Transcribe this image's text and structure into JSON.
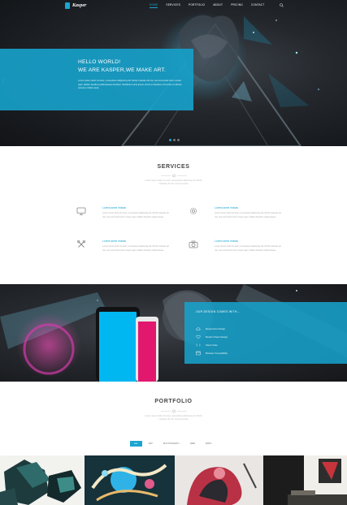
{
  "nav": {
    "logo": "Kasper",
    "items": [
      {
        "label": "HOME",
        "active": true
      },
      {
        "label": "SERVICES",
        "active": false
      },
      {
        "label": "PORTFOLIO",
        "active": false
      },
      {
        "label": "ABOUT",
        "active": false
      },
      {
        "label": "PRICING",
        "active": false
      },
      {
        "label": "CONTACT",
        "active": false
      }
    ],
    "search_icon": "search-icon"
  },
  "hero": {
    "title_line1": "HELLO WORLD!",
    "title_line2": "WE ARE KASPER,WE MAKE ART.",
    "text": "Lorem ipsum dolor sit amet, consectetur adipiscing elit. Morbi molestie elit nisi, sed commodo lorem ornare eget. Nullam faucibus pellentesque tincidunt. Vestibulum ante ipsum primis in faucibus orci luctus et ultrices posuere cubilia curae.",
    "accent": "#1ba5d1",
    "slides": 3,
    "active_slide": 1
  },
  "services": {
    "title": "SERVICES",
    "subtitle_line1": "Lorem ipsum dolor sit amet, consectetur adipiscing elit. Morbi",
    "subtitle_line2": "molestie elit nisi, sed commodo",
    "items": [
      {
        "icon": "monitor-icon",
        "title": "Lorem amet irnidas",
        "text": "Lorem ipsum dolor sit amet, consectetur adipiscing elit. Morbi molestie elit nisi, sed commodo lorem ornare eget. Nullam faucibus pellentesque."
      },
      {
        "icon": "gear-icon",
        "title": "Lorem amet irnidas",
        "text": "Lorem ipsum dolor sit amet, consectetur adipiscing elit. Morbi molestie elit nisi, sed commodo lorem ornare eget. Nullam faucibus pellentesque."
      },
      {
        "icon": "tools-icon",
        "title": "Lorem amet irnidas",
        "text": "Lorem ipsum dolor sit amet, consectetur adipiscing elit. Morbi molestie elit nisi, sed commodo lorem ornare eget. Nullam faucibus pellentesque."
      },
      {
        "icon": "camera-icon",
        "title": "Lorem amet irnidas",
        "text": "Lorem ipsum dolor sit amet, consectetur adipiscing elit. Morbi molestie elit nisi, sed commodo lorem ornare eget. Nullam faucibus pellentesque."
      }
    ]
  },
  "features": {
    "title": "OUR DESIGN COMES WITH...",
    "items": [
      {
        "icon": "cloud-icon",
        "label": "Responsive Design"
      },
      {
        "icon": "heart-icon",
        "label": "Modern Clean Design"
      },
      {
        "icon": "code-icon",
        "label": "Clean Code"
      },
      {
        "icon": "browser-icon",
        "label": "Browser Compatibility"
      }
    ],
    "phone_colors": [
      "#00b7f1",
      "#e2186f"
    ]
  },
  "portfolio": {
    "title": "PORTFOLIO",
    "subtitle_line1": "Lorem ipsum dolor sit amet, consectetur adipiscing elit. Morbi",
    "subtitle_line2": "molestie elit nisi, sed commodo",
    "filters": [
      {
        "label": "ALL",
        "active": true
      },
      {
        "label": "APP",
        "active": false
      },
      {
        "label": "PHOTOGRAPHY",
        "active": false
      },
      {
        "label": "WEB",
        "active": false
      },
      {
        "label": "PRINT",
        "active": false
      }
    ]
  }
}
